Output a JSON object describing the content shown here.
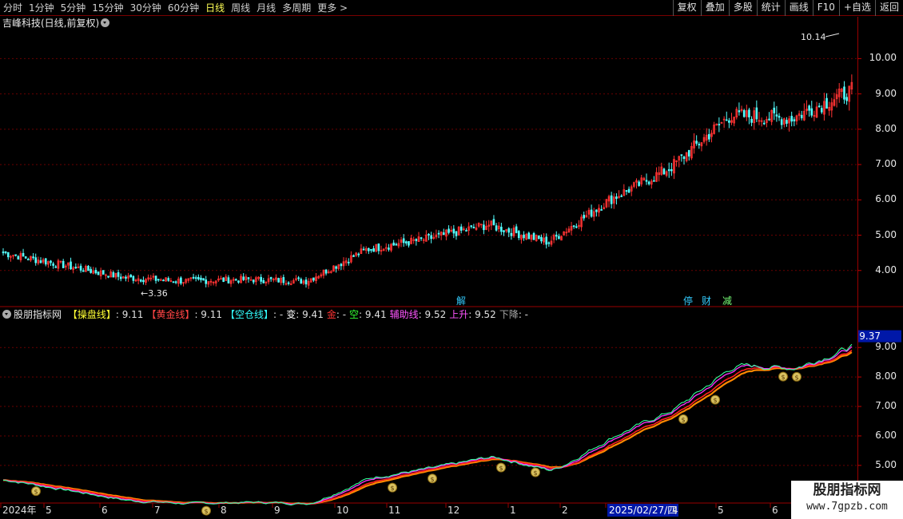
{
  "toolbar": {
    "periods": [
      {
        "label": "分时",
        "active": false
      },
      {
        "label": "1分钟",
        "active": false
      },
      {
        "label": "5分钟",
        "active": false
      },
      {
        "label": "15分钟",
        "active": false
      },
      {
        "label": "30分钟",
        "active": false
      },
      {
        "label": "60分钟",
        "active": false
      },
      {
        "label": "日线",
        "active": true
      },
      {
        "label": "周线",
        "active": false
      },
      {
        "label": "月线",
        "active": false
      },
      {
        "label": "多周期",
        "active": false
      },
      {
        "label": "更多 >",
        "active": false
      }
    ],
    "tools": [
      "复权",
      "叠加",
      "多股",
      "统计",
      "画线",
      "F10",
      "+自选",
      "返回"
    ]
  },
  "price_panel": {
    "title": "吉峰科技(日线,前复权)",
    "high_label": "10.14",
    "low_label": "3.36",
    "y_ticks": [
      "10.00",
      "9.00",
      "8.00",
      "7.00",
      "6.00",
      "5.00",
      "4.00"
    ],
    "markers": [
      {
        "label": "解",
        "color": "#33ccff"
      },
      {
        "label": "停",
        "color": "#33ccff"
      },
      {
        "label": "财",
        "color": "#33ccff"
      },
      {
        "label": "减",
        "color": "#77ff77"
      }
    ]
  },
  "indicator_panel": {
    "name": "股朋指标网",
    "items": [
      {
        "label": "【操盘线】",
        "value": ": 9.11",
        "color": "#ffff33"
      },
      {
        "label": "【黄金线】",
        "value": ": 9.11",
        "color": "#ff4444"
      },
      {
        "label": "【空仓线】",
        "value": ": -",
        "color": "#33ffff"
      },
      {
        "label": "变",
        "value": ": 9.41",
        "color": "#ffffff"
      },
      {
        "label": "金",
        "value": ": -",
        "color": "#ff3333"
      },
      {
        "label": "空",
        "value": ": 9.41",
        "color": "#33ff33"
      },
      {
        "label": "辅助线",
        "value": ": 9.52",
        "color": "#ff55ff"
      },
      {
        "label": "上升",
        "value": ": 9.52",
        "color": "#ff55ff"
      },
      {
        "label": "下降",
        "value": ": -",
        "color": "#aaaaaa"
      }
    ],
    "current_value": "9.37",
    "y_ticks": [
      "9.00",
      "8.00",
      "7.00",
      "6.00",
      "5.00"
    ]
  },
  "x_axis": {
    "labels": [
      "2024年",
      "5",
      "6",
      "7",
      "8",
      "9",
      "10",
      "11",
      "12",
      "1",
      "2",
      "2025/02/27/四",
      "4",
      "5",
      "6"
    ]
  },
  "watermark": {
    "line1": "股朋指标网",
    "line2": "www.7gpzb.com"
  },
  "chart_data": {
    "type": "candlestick",
    "colors": {
      "up": "#ff3333",
      "down": "#54ffff",
      "ma_gold": "#ff8800",
      "ma_red": "#ff2020",
      "ma_magenta": "#ff33ff",
      "ma_green": "#33ff99"
    },
    "price_ylim": [
      3.0,
      10.8
    ],
    "indicator_ylim": [
      4.4,
      9.9
    ],
    "monthly_close": [
      {
        "month": "2024-04",
        "close": 4.5
      },
      {
        "month": "2024-05",
        "close": 4.15
      },
      {
        "month": "2024-06",
        "close": 3.8
      },
      {
        "month": "2024-07",
        "close": 3.7
      },
      {
        "month": "2024-08",
        "close": 3.75
      },
      {
        "month": "2024-09",
        "close": 3.7
      },
      {
        "month": "2024-10",
        "close": 4.6
      },
      {
        "month": "2024-11",
        "close": 4.9
      },
      {
        "month": "2024-12",
        "close": 5.3
      },
      {
        "month": "2025-01",
        "close": 4.8
      },
      {
        "month": "2025-02",
        "close": 6.0
      },
      {
        "month": "2025-03",
        "close": 6.9
      },
      {
        "month": "2025-04",
        "close": 8.4
      },
      {
        "month": "2025-05",
        "close": 8.3
      },
      {
        "month": "2025-06",
        "close": 9.1
      }
    ]
  }
}
